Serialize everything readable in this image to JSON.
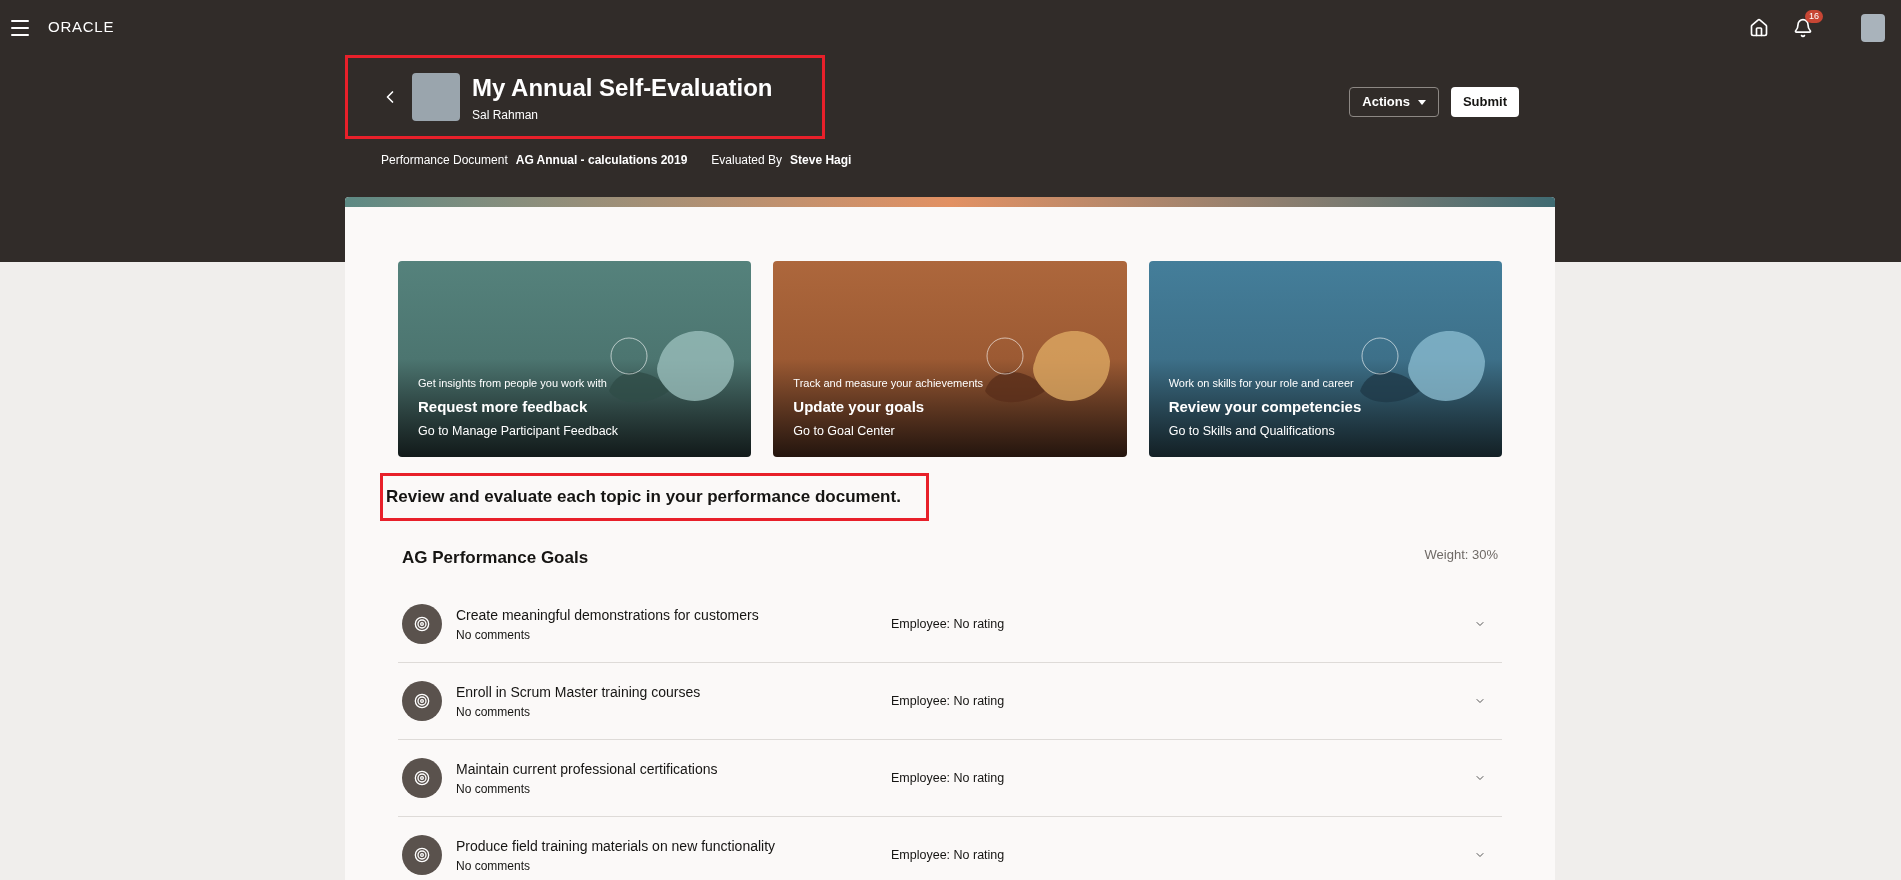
{
  "top_bar": {
    "logo": "ORACLE",
    "notification_count": "16"
  },
  "header": {
    "title": "My Annual Self-Evaluation",
    "person": "Sal Rahman",
    "meta": [
      {
        "label": "Performance Document",
        "value": "AG Annual - calculations 2019"
      },
      {
        "label": "Evaluated By",
        "value": "Steve Hagi"
      }
    ],
    "actions_button": "Actions",
    "submit_button": "Submit"
  },
  "promo_cards": [
    {
      "kind": "feedback",
      "caption": "Get insights from people you work with",
      "title": "Request more feedback",
      "link": "Go to Manage Participant Feedback"
    },
    {
      "kind": "goals",
      "caption": "Track and measure your achievements",
      "title": "Update your goals",
      "link": "Go to Goal Center"
    },
    {
      "kind": "skills",
      "caption": "Work on skills for your role and career",
      "title": "Review your competencies",
      "link": "Go to Skills and Qualifications"
    }
  ],
  "instruction": "Review and evaluate each topic in your performance document.",
  "section": {
    "title": "AG Performance Goals",
    "weight": "Weight: 30%",
    "goals": [
      {
        "name": "Create meaningful demonstrations for customers",
        "comments": "No comments",
        "rating": "Employee: No rating"
      },
      {
        "name": "Enroll in Scrum Master training courses",
        "comments": "No comments",
        "rating": "Employee: No rating"
      },
      {
        "name": "Maintain current professional certifications",
        "comments": "No comments",
        "rating": "Employee: No rating"
      },
      {
        "name": "Produce field training materials on new functionality",
        "comments": "No comments",
        "rating": "Employee: No rating"
      }
    ]
  }
}
